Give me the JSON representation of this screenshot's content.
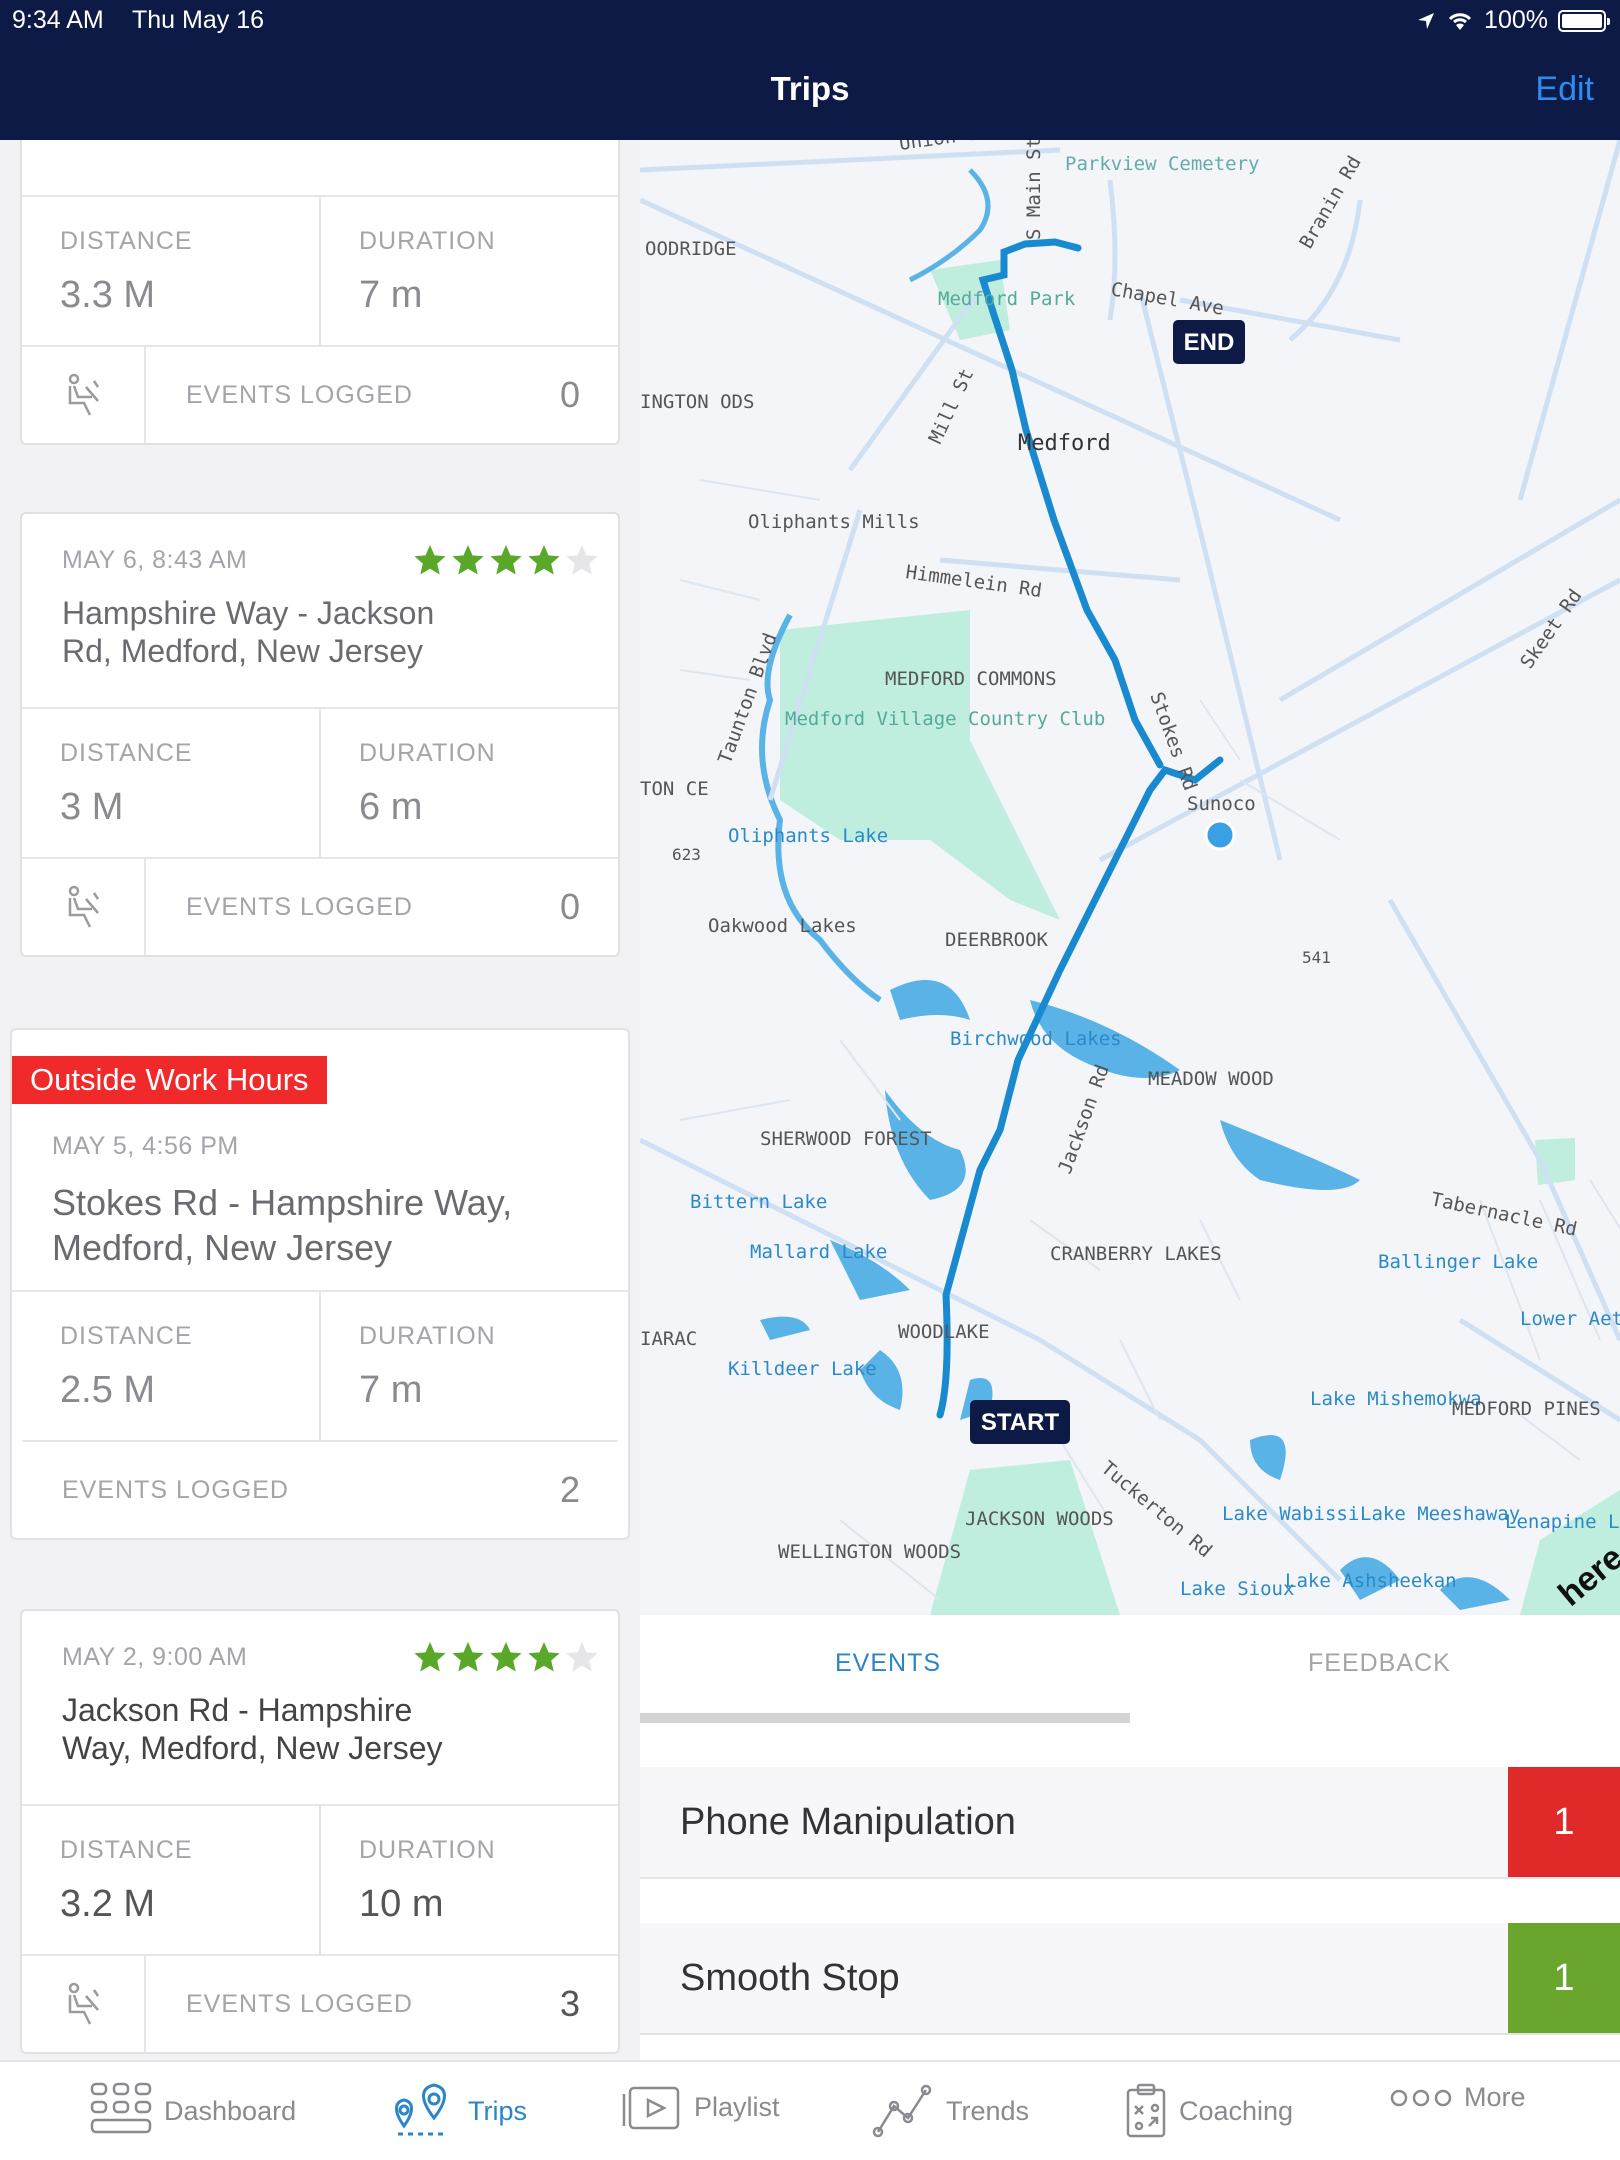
{
  "status": {
    "time": "9:34 AM",
    "date": "Thu May 16",
    "battery": "100%"
  },
  "nav": {
    "title": "Trips",
    "edit": "Edit"
  },
  "trips": [
    {
      "distance_label": "DISTANCE",
      "distance": "3.3 M",
      "duration_label": "DURATION",
      "duration": "7 m",
      "events_label": "EVENTS LOGGED",
      "events": "0"
    },
    {
      "time": "MAY 6, 8:43 AM",
      "address": "Hampshire Way - Jackson Rd, Medford, New Jersey",
      "rating": 4,
      "distance_label": "DISTANCE",
      "distance": "3 M",
      "duration_label": "DURATION",
      "duration": "6 m",
      "events_label": "EVENTS LOGGED",
      "events": "0"
    },
    {
      "badge": "Outside Work Hours",
      "time": "MAY 5, 4:56 PM",
      "address": "Stokes Rd - Hampshire Way, Medford, New Jersey",
      "distance_label": "DISTANCE",
      "distance": "2.5 M",
      "duration_label": "DURATION",
      "duration": "7 m",
      "events_label": "EVENTS LOGGED",
      "events": "2"
    },
    {
      "time": "MAY 2, 9:00 AM",
      "address": "Jackson Rd - Hampshire Way, Medford, New Jersey",
      "rating": 4,
      "distance_label": "DISTANCE",
      "distance": "3.2 M",
      "duration_label": "DURATION",
      "duration": "10 m",
      "events_label": "EVENTS LOGGED",
      "events": "3"
    }
  ],
  "map": {
    "start": "START",
    "end": "END",
    "labels": [
      "Union St",
      "Parkview Cemetery",
      "OODRIDGE",
      "S Main St",
      "Chapel Ave",
      "Branin Rd",
      "Medford Park",
      "INGTON ODS",
      "Mill St",
      "Medford",
      "Oliphants Mills",
      "Himmelein Rd",
      "Skeet Rd",
      "MEDFORD COMMONS",
      "Taunton Blvd",
      "Medford Village Country Club",
      "Stokes Rd",
      "Sunoco",
      "TON CE",
      "Oliphants Lake",
      "623",
      "Oakwood Lakes",
      "DEERBROOK",
      "541",
      "Birchwood Lakes",
      "MEADOW WOOD",
      "Jackson Rd",
      "SHERWOOD FOREST",
      "Tabernacle Rd",
      "Bittern Lake",
      "Mallard Lake",
      "CRANBERRY LAKES",
      "Ballinger Lake",
      "Lower Aetna Lake",
      "IARAC",
      "WOODLAKE",
      "Killdeer Lake",
      "Lake Mishemokwa",
      "MEDFORD PINES",
      "Tuckerton Rd",
      "JACKSON WOODS",
      "Lake Wabissi",
      "Lake Meeshaway",
      "Lenapine Lake",
      "WELLINGTON WOODS",
      "Lake Ashsheekan",
      "Lake Sioux",
      "here"
    ]
  },
  "detail_tabs": {
    "events": "EVENTS",
    "feedback": "FEEDBACK"
  },
  "event_rows": [
    {
      "name": "Phone Manipulation",
      "count": "1",
      "color": "#e02a2a"
    },
    {
      "name": "Smooth Stop",
      "count": "1",
      "color": "#6aa52e"
    }
  ],
  "tabbar": {
    "dashboard": "Dashboard",
    "trips": "Trips",
    "playlist": "Playlist",
    "trends": "Trends",
    "coaching": "Coaching",
    "more": "More"
  },
  "colors": {
    "nav": "#0c1a45",
    "accent": "#2b86c8",
    "route": "#1a8ad0",
    "star": "#5aa82a"
  }
}
